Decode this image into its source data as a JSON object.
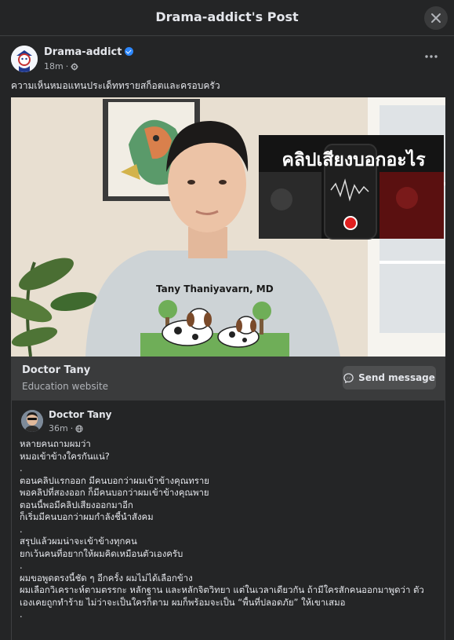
{
  "modal": {
    "title": "Drama-addict's Post"
  },
  "post": {
    "author": "Drama-addict",
    "time": "18m",
    "privacy_icon": "gear-icon",
    "verified_icon": "verified-badge-icon",
    "caption": "ความเห็นหมอแทนประเด็ททรายสก็อตและครอบครัว"
  },
  "video": {
    "overlay_title": "คลิปเสียงบอกอะไร",
    "shirt_name": "Tany Thaniyavarn, MD"
  },
  "link_card": {
    "name": "Doctor Tany",
    "subtitle": "Education website",
    "button_label": "Send message",
    "button_icon": "messenger-icon"
  },
  "shared_post": {
    "author": "Doctor Tany",
    "time": "36m",
    "privacy_icon": "globe-icon",
    "lines": [
      "หลายคนถามผมว่า",
      "หมอเข้าข้างใครกันแน่?",
      ".",
      "ตอนคลิปแรกออก มีคนบอกว่าผมเข้าข้างคุณทราย",
      "พอคลิปที่สองออก ก็มีคนบอกว่าผมเข้าข้างคุณพาย",
      "ตอนนี้พอมีคลิปเสียงออกมาอีก",
      "ก็เริ่มมีคนบอกว่าผมกำลังชี้นำสังคม",
      ".",
      "สรุปแล้วผมน่าจะเข้าข้างทุกคน",
      "ยกเว้นคนที่อยากให้ผมคิดเหมือนตัวเองครับ",
      ".",
      "ผมขอพูดตรงนี้ชัด ๆ อีกครั้ง ผมไม่ได้เลือกข้าง",
      "ผมเลือกวิเคราะห์ตามตรรกะ หลักฐาน และหลักจิตวิทยา แต่ในเวลาเดียวกัน ถ้ามีใครสักคนออกมาพูดว่า ตัว",
      "เองเคยถูกทำร้าย ไม่ว่าจะเป็นใครก็ตาม ผมก็พร้อมจะเป็น “พื้นที่ปลอดภัย” ให้เขาเสมอ",
      "."
    ]
  },
  "colors": {
    "background": "#242526",
    "card": "#3a3b3c",
    "accent": "#2d88ff",
    "text": "#e4e6eb",
    "muted": "#b0b3b8"
  }
}
